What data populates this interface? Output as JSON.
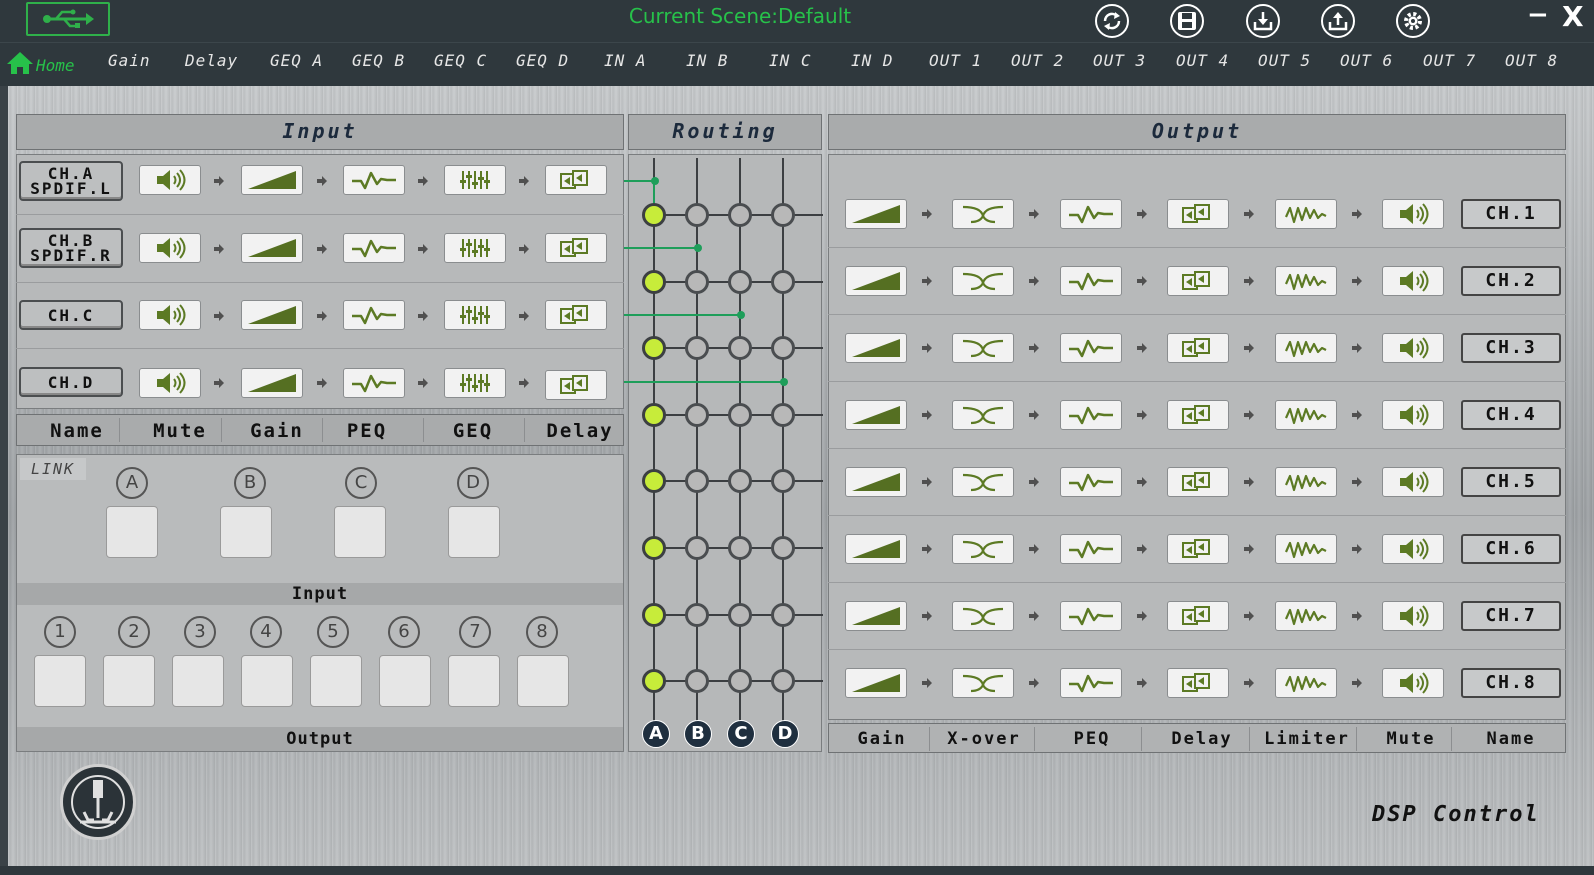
{
  "app": {
    "scene_title": "Current Scene:Default",
    "brand": "DSP Control",
    "window_min": "−",
    "window_close": "X"
  },
  "colors": {
    "accent_green": "#27c14a",
    "icon_green": "#5c7a24",
    "node_green": "#c7ec3a",
    "route_line": "#1e9e5a"
  },
  "toolbar": {
    "icons": [
      "usb-icon",
      "refresh-icon",
      "save-icon",
      "download-icon",
      "upload-icon",
      "settings-icon"
    ]
  },
  "nav": {
    "home": "Home",
    "items": [
      "Gain",
      "Delay",
      "GEQ A",
      "GEQ B",
      "GEQ C",
      "GEQ D",
      "IN A",
      "IN B",
      "IN C",
      "IN D",
      "OUT 1",
      "OUT 2",
      "OUT 3",
      "OUT 4",
      "OUT 5",
      "OUT 6",
      "OUT 7",
      "OUT 8"
    ]
  },
  "input": {
    "title": "Input",
    "channels": [
      {
        "line1": "CH.A",
        "line2": "SPDIF.L"
      },
      {
        "line1": "CH.B",
        "line2": "SPDIF.R"
      },
      {
        "line1": "CH.C",
        "line2": ""
      },
      {
        "line1": "CH.D",
        "line2": ""
      }
    ],
    "columns": [
      "Name",
      "Mute",
      "Gain",
      "PEQ",
      "GEQ",
      "Delay"
    ]
  },
  "routing": {
    "title": "Routing",
    "inputs": [
      "A",
      "B",
      "C",
      "D"
    ],
    "outputs": 8,
    "active_input_per_output": [
      "A",
      "A",
      "A",
      "A",
      "A",
      "A",
      "A",
      "A"
    ]
  },
  "output": {
    "title": "Output",
    "channels": [
      "CH.1",
      "CH.2",
      "CH.3",
      "CH.4",
      "CH.5",
      "CH.6",
      "CH.7",
      "CH.8"
    ],
    "columns": [
      "Gain",
      "X-over",
      "PEQ",
      "Delay",
      "Limiter",
      "Mute",
      "Name"
    ]
  },
  "link": {
    "label": "LINK",
    "input_title": "Input",
    "output_title": "Output",
    "inputs": [
      "A",
      "B",
      "C",
      "D"
    ],
    "outputs": [
      "1",
      "2",
      "3",
      "4",
      "5",
      "6",
      "7",
      "8"
    ]
  }
}
